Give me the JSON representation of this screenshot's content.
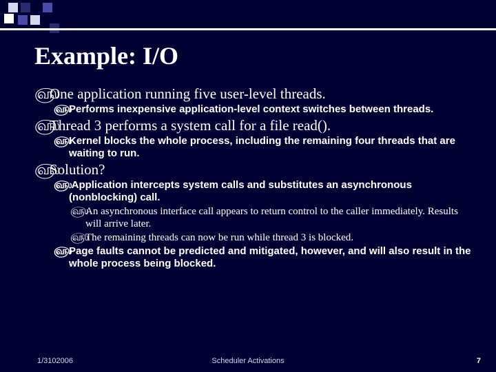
{
  "title": "Example: I/O",
  "bullets": {
    "p1": "One application running five user-level threads.",
    "p1a": "Performs inexpensive application-level context switches between threads.",
    "p2": "Thread 3 performs a system call for a file read().",
    "p2a": "Kernel blocks the whole process, including the remaining four threads that are waiting to run.",
    "p3": "Solution?",
    "p3a": " Application intercepts system calls and substitutes an asynchronous (nonblocking) call.",
    "p3a_i": "An asynchronous interface call appears to return control to the caller immediately.  Results will arrive later.",
    "p3a_ii": "The remaining threads can now be run while thread 3 is blocked.",
    "p3b": "Page faults cannot be predicted and mitigated, however, and will also result in the whole process being blocked."
  },
  "footer": {
    "date": "1/3102006",
    "title": "Scheduler Activations",
    "page": "7"
  },
  "glyph": "௵"
}
